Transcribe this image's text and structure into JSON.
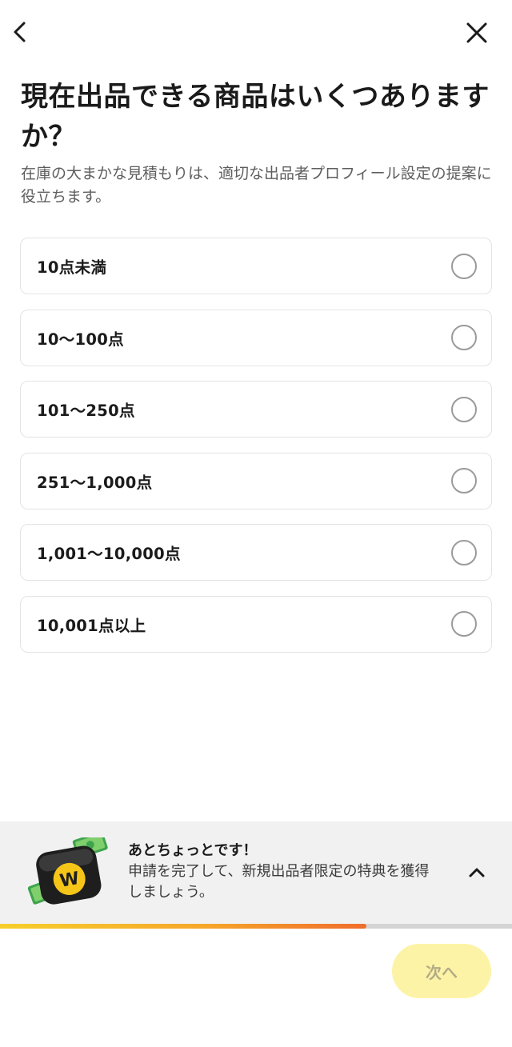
{
  "header": {
    "back_icon": "chevron-left-icon",
    "close_icon": "close-icon"
  },
  "question": {
    "title": "現在出品できる商品はいくつありますか？",
    "subtitle": "在庫の大まかな見積もりは、適切な出品者プロフィール設定の提案に役立ちます。"
  },
  "options": [
    {
      "label": "10点未満",
      "selected": false
    },
    {
      "label": "10〜100点",
      "selected": false
    },
    {
      "label": "101〜250点",
      "selected": false
    },
    {
      "label": "251〜1,000点",
      "selected": false
    },
    {
      "label": "1,001〜10,000点",
      "selected": false
    },
    {
      "label": "10,001点以上",
      "selected": false
    }
  ],
  "promo": {
    "title": "あとちょっとです！",
    "body": "申請を完了して、新規出品者限定の特典を獲得しましょう。",
    "icon": "wallet-money-icon",
    "toggle_icon": "chevron-up-icon"
  },
  "progress": {
    "value": 0.715,
    "colors": [
      "#f6cf2c",
      "#f6a72b",
      "#ef6d2c"
    ]
  },
  "footer": {
    "next_label": "次へ",
    "next_enabled": false
  },
  "colors": {
    "accent": "#fdf3a6",
    "accent_text": "#b3ab86"
  }
}
